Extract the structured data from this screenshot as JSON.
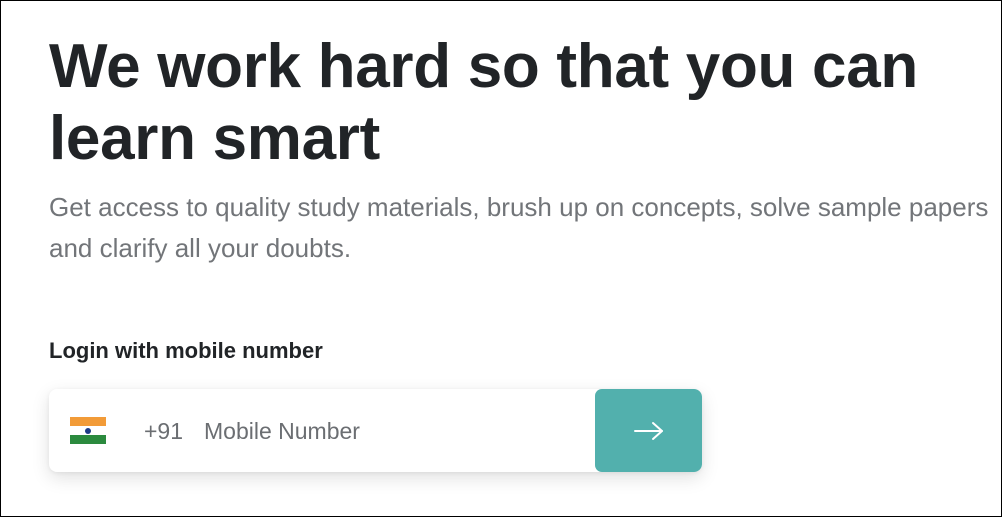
{
  "hero": {
    "title": "We work hard so that you can learn smart",
    "subtitle": "Get access to quality study materials, brush up on concepts, solve sample papers and clarify all your doubts."
  },
  "login": {
    "label": "Login with mobile number",
    "country_flag_icon": "india-flag-icon",
    "country_code": "+91",
    "mobile_placeholder": "Mobile Number",
    "mobile_value": "",
    "submit_icon": "arrow-right-icon"
  },
  "colors": {
    "heading": "#212427",
    "subtext": "#727579",
    "accent": "#52b0ad"
  }
}
